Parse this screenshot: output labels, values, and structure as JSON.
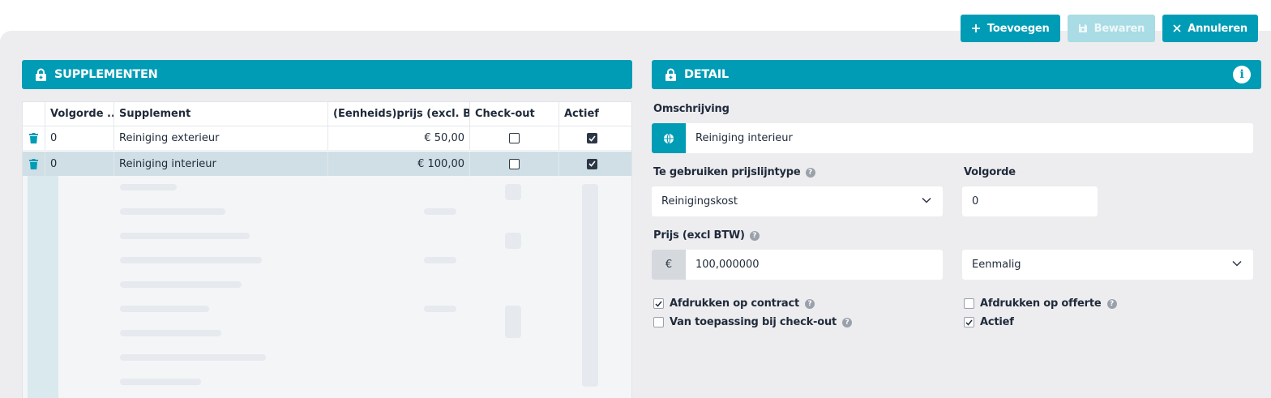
{
  "toolbar": {
    "add_label": "Toevoegen",
    "save_label": "Bewaren",
    "cancel_label": "Annuleren"
  },
  "left_panel": {
    "title": "SUPPLEMENTEN",
    "columns": [
      "Volgorde ...",
      "Supplement",
      "(Eenheids)prijs (excl. BT...",
      "Check-out",
      "Actief"
    ],
    "rows": [
      {
        "order": "0",
        "supplement": "Reiniging exterieur",
        "price": "€ 50,00",
        "checkout": false,
        "active": true
      },
      {
        "order": "0",
        "supplement": "Reiniging interieur",
        "price": "€ 100,00",
        "checkout": false,
        "active": true
      }
    ]
  },
  "right_panel": {
    "title": "DETAIL",
    "description_label": "Omschrijving",
    "description_value": "Reiniging interieur",
    "price_line_type_label": "Te gebruiken prijslijntype",
    "price_line_type_value": "Reinigingskost",
    "order_label": "Volgorde",
    "order_value": "0",
    "price_label": "Prijs (excl BTW)",
    "currency_symbol": "€",
    "price_value": "100,000000",
    "frequency_value": "Eenmalig",
    "print_contract_label": "Afdrukken op contract",
    "print_contract_checked": true,
    "print_quote_label": "Afdrukken op offerte",
    "print_quote_checked": false,
    "checkout_label": "Van toepassing bij check-out",
    "checkout_checked": false,
    "active_label": "Actief",
    "active_checked": true
  },
  "icons": {
    "add": "plus-icon",
    "save": "floppy-disk-icon",
    "cancel": "close-icon",
    "panel": "lock-icon",
    "info": "info-icon",
    "delete": "trash-icon",
    "language": "globe-icon",
    "help": "question-icon",
    "dropdown": "chevron-down-icon"
  },
  "colors": {
    "accent": "#009cb5",
    "accent_disabled": "#a9dce4",
    "background": "#ededf0",
    "selected_row": "#cfdfe5"
  }
}
